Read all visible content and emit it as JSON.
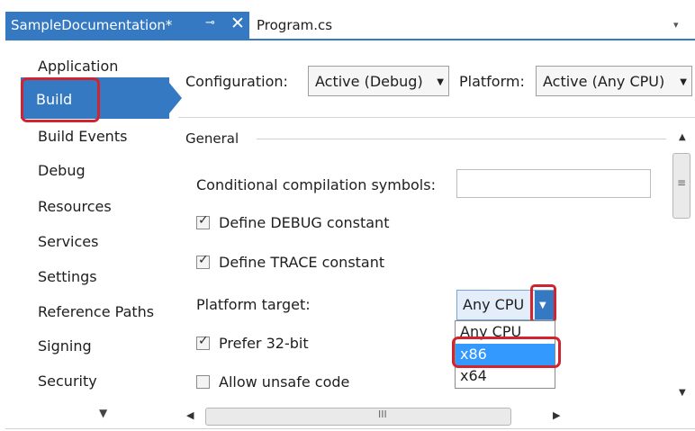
{
  "tabs": [
    {
      "label": "SampleDocumentation*",
      "active": true,
      "pin_icon": "pin-icon",
      "close_icon": "close-icon",
      "close_glyph": "✕",
      "pin_glyph": "⊸"
    },
    {
      "label": "Program.cs",
      "active": false
    }
  ],
  "tab_menu_glyph": "▾",
  "nav": {
    "items": [
      {
        "label": "Application",
        "selected": false
      },
      {
        "label": "Build",
        "selected": true
      },
      {
        "label": "Build Events",
        "selected": false
      },
      {
        "label": "Debug",
        "selected": false
      },
      {
        "label": "Resources",
        "selected": false
      },
      {
        "label": "Services",
        "selected": false
      },
      {
        "label": "Settings",
        "selected": false
      },
      {
        "label": "Reference Paths",
        "selected": false
      },
      {
        "label": "Signing",
        "selected": false
      },
      {
        "label": "Security",
        "selected": false
      }
    ],
    "scroll_glyph": "▼"
  },
  "config": {
    "configuration_label": "Configuration:",
    "configuration_value": "Active (Debug)",
    "platform_label": "Platform:",
    "platform_value": "Active (Any CPU)",
    "arrow_glyph": "▼"
  },
  "general": {
    "section_label": "General",
    "symbols_label": "Conditional compilation symbols:",
    "symbols_value": "",
    "define_debug_label": "Define DEBUG constant",
    "define_debug_checked": true,
    "define_trace_label": "Define TRACE constant",
    "define_trace_checked": true,
    "platform_target_label": "Platform target:",
    "platform_target_value": "Any CPU",
    "platform_target_options": [
      "Any CPU",
      "x86",
      "x64"
    ],
    "platform_target_highlighted": "x86",
    "prefer32_label": "Prefer 32-bit",
    "prefer32_checked": true,
    "unsafe_label": "Allow unsafe code",
    "unsafe_checked": false,
    "check_glyph": "✓"
  },
  "scrollbars": {
    "up_glyph": "▲",
    "down_glyph": "▼",
    "left_glyph": "◀",
    "right_glyph": "▶",
    "grip_v": "≡",
    "grip_h": "III"
  },
  "colors": {
    "accent": "#3479c2",
    "highlight_outline": "#d02530",
    "selection": "#3399ff"
  }
}
